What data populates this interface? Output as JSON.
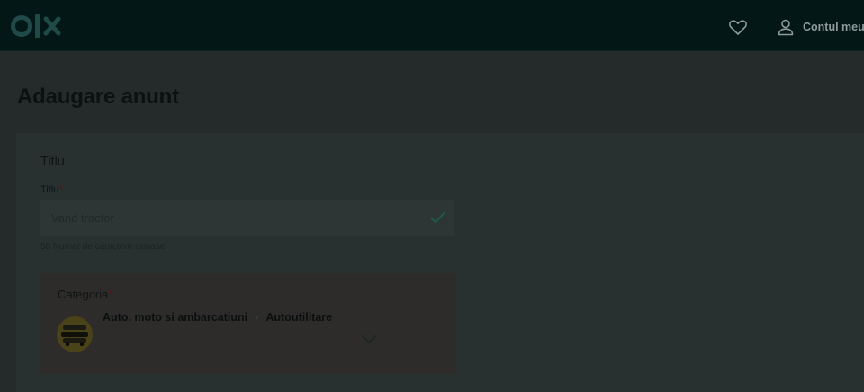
{
  "header": {
    "logo_text": "olx",
    "favorites_icon": "heart-icon",
    "account_icon": "user-icon",
    "account_label": "Contul meu"
  },
  "page": {
    "title": "Adaugare anunt"
  },
  "title_section": {
    "heading": "Titlu",
    "field_label": "Titlu",
    "required_mark": "*",
    "input_value": "Vand tractor",
    "valid_icon": "check-icon",
    "char_counter": "58 Numar de caractere ramase"
  },
  "category": {
    "label": "Categoria",
    "required_mark": "*",
    "path_1": "Auto, moto si ambarcatiuni",
    "separator": "›",
    "path_2": "Autoutilitare",
    "thumb_icon": "vehicle-category-icon",
    "dropdown_icon": "chevron-down-icon"
  },
  "colors": {
    "header_bg": "#031717",
    "overlay_page_bg": "#252a2a",
    "valid_check": "#1f5a4a"
  }
}
